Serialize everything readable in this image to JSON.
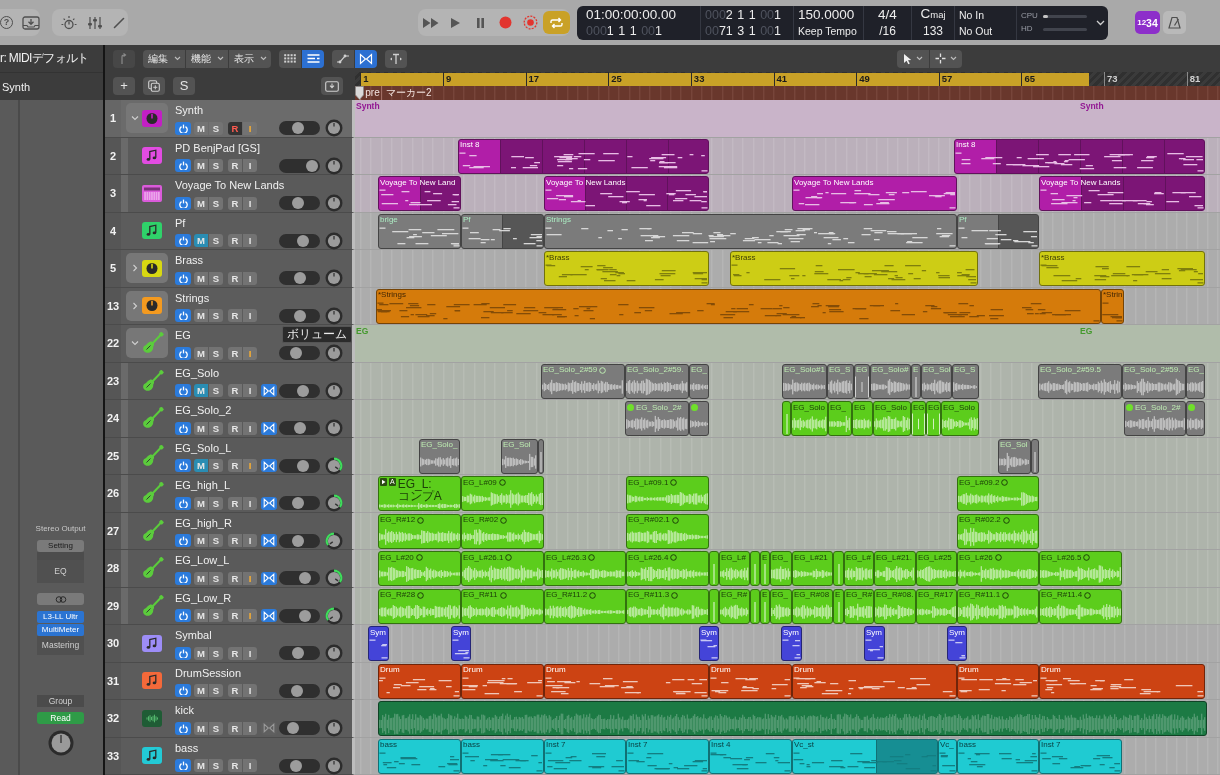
{
  "control_bar": {
    "help_label": "?",
    "cycle": {
      "on": true
    },
    "count_in": {
      "label": "1234",
      "on": true
    }
  },
  "lcd": {
    "smpte": "01:00:00:00.00",
    "position": "0001 1 1 001",
    "left_locator": "0002 1 1 001",
    "right_locator": "0071 3 1 001",
    "tempo": "150.0000",
    "tempo_mode": "Keep Tempo",
    "time_signature": "4/4",
    "division": "/16",
    "key": {
      "root": "C",
      "mode": "maj"
    },
    "key_row_2": "133",
    "midi_in": "No In",
    "midi_out": "No Out",
    "meters": [
      {
        "label": "CPU",
        "level": 0.12
      },
      {
        "label": "HD",
        "level": 0
      }
    ]
  },
  "inspector": {
    "title": "r: MIDIデフォルト",
    "track": "Synth",
    "channel_strip": {
      "output": "Stereo Output",
      "setting": "Setting",
      "eq": "EQ",
      "plugins": [
        "L3-LL Ultr",
        "MultiMeter"
      ],
      "slot": "Mastering",
      "group": "Group",
      "automation": "Read"
    }
  },
  "arrange_toolbar": {
    "menus": [
      {
        "label": "編集"
      },
      {
        "label": "機能"
      },
      {
        "label": "表示"
      }
    ],
    "view_buttons": [
      {
        "kind": "grid",
        "selected": false
      },
      {
        "kind": "list",
        "selected": true
      }
    ],
    "mode_buttons": [
      {
        "kind": "automation",
        "selected": false
      },
      {
        "kind": "flex",
        "selected": true
      }
    ]
  },
  "track_actions": [
    {
      "kind": "add",
      "label": "+"
    },
    {
      "kind": "duplicate"
    },
    {
      "kind": "solo",
      "label": "S"
    }
  ],
  "ruler": {
    "bars": [
      "1",
      "9",
      "17",
      "25",
      "33",
      "41",
      "49",
      "57",
      "65",
      "73",
      "81"
    ],
    "markers": [
      {
        "label": "pre"
      },
      {
        "label": "マーカー2"
      }
    ]
  },
  "tracks": [
    {
      "number": "1",
      "name": "Synth",
      "kind": "stack",
      "selected": true,
      "expanded": true,
      "color": "#c21fc4",
      "power": true,
      "buttons": [
        {
          "kind": "mute",
          "label": "M",
          "on": false
        },
        {
          "kind": "solo",
          "label": "S",
          "on": false
        },
        {
          "kind": "record",
          "label": "R",
          "on": true
        },
        {
          "kind": "input",
          "label": "I",
          "on": true
        }
      ],
      "volume": {
        "level": 0.46
      },
      "pan": {
        "left": false,
        "right": false
      },
      "regions": [
        {
          "label": "Synth",
          "color": "#c9b4c9"
        },
        {
          "label": "Synth",
          "color": "#c9b4c9"
        }
      ],
      "children": [
        {
          "number": "2",
          "name": "PD BenjPad [GS]",
          "kind": "instrument",
          "selected": false,
          "color": "#e24ce2",
          "power": true,
          "buttons": [
            {
              "kind": "mute",
              "label": "M",
              "on": false
            },
            {
              "kind": "solo",
              "label": "S",
              "on": false
            },
            {
              "kind": "record",
              "label": "R",
              "on": false
            },
            {
              "kind": "input",
              "label": "I",
              "on": false
            }
          ],
          "volume": {
            "level": 0.95
          },
          "pan": {
            "left": false,
            "right": false
          },
          "regions": [
            {
              "label": "Inst 8",
              "color": "#b11ea8"
            },
            {
              "label": "Inst 8",
              "color": "#b11ea8"
            }
          ]
        },
        {
          "number": "3",
          "name": "Voyage To New Lands",
          "kind": "synth",
          "selected": false,
          "color": "#da5bda",
          "power": true,
          "buttons": [
            {
              "kind": "mute",
              "label": "M",
              "on": false
            },
            {
              "kind": "solo",
              "label": "S",
              "on": false
            },
            {
              "kind": "record",
              "label": "R",
              "on": false
            },
            {
              "kind": "input",
              "label": "I",
              "on": false
            }
          ],
          "volume": {
            "level": 0.46
          },
          "pan": {
            "left": false,
            "right": false
          },
          "regions": [
            {
              "label": "Voyage To New Land",
              "color": "#b11ea8"
            },
            {
              "label": "Voyage To New Lands",
              "color": "#b11ea8"
            },
            {
              "label": "Voyage To New Lands",
              "color": "#b11ea8"
            },
            {
              "label": "Voyage To New Lands",
              "color": "#b11ea8"
            }
          ]
        }
      ]
    },
    {
      "number": "4",
      "name": "Pf",
      "kind": "instrument",
      "selected": false,
      "color": "#2fd26a",
      "power": true,
      "buttons": [
        {
          "kind": "mute",
          "label": "M",
          "on": true
        },
        {
          "kind": "solo",
          "label": "S",
          "on": false
        },
        {
          "kind": "record",
          "label": "R",
          "on": false
        },
        {
          "kind": "input",
          "label": "I",
          "on": false
        }
      ],
      "volume": {
        "level": 0.64
      },
      "pan": {
        "left": false,
        "right": false
      },
      "regions": [
        {
          "label": "brige"
        },
        {
          "label": "Pf"
        },
        {
          "label": "Strings"
        },
        {
          "label": "Pf"
        }
      ]
    },
    {
      "number": "5",
      "name": "Brass",
      "kind": "stack",
      "selected": false,
      "expanded": false,
      "color": "#d8d812",
      "power": true,
      "buttons": [
        {
          "kind": "mute",
          "label": "M",
          "on": false
        },
        {
          "kind": "solo",
          "label": "S",
          "on": false
        },
        {
          "kind": "record",
          "label": "R",
          "on": false
        },
        {
          "kind": "input",
          "label": "I",
          "on": false
        }
      ],
      "volume": {
        "level": 0.5
      },
      "pan": {
        "left": false,
        "right": false
      },
      "regions": [
        {
          "label": "*Brass",
          "color": "#cdcd15"
        },
        {
          "label": "*Brass",
          "color": "#cdcd15"
        },
        {
          "label": "*Brass",
          "color": "#cdcd15"
        }
      ]
    },
    {
      "number": "13",
      "name": "Strings",
      "kind": "stack",
      "selected": false,
      "expanded": false,
      "color": "#f39a20",
      "power": true,
      "buttons": [
        {
          "kind": "mute",
          "label": "M",
          "on": false
        },
        {
          "kind": "solo",
          "label": "S",
          "on": false
        },
        {
          "kind": "record",
          "label": "R",
          "on": false
        },
        {
          "kind": "input",
          "label": "I",
          "on": false
        }
      ],
      "volume": {
        "level": 0.5
      },
      "pan": {
        "left": false,
        "right": false
      },
      "regions": [
        {
          "label": "*Strings",
          "color": "#d57b0b"
        },
        {
          "label": "*Strin",
          "color": "#d57b0b"
        }
      ]
    },
    {
      "number": "22",
      "name": "EG",
      "kind": "guitar_stack",
      "selected": false,
      "expanded": true,
      "color": "#5bcc3c",
      "power": true,
      "tooltip": "ボリューム",
      "buttons": [
        {
          "kind": "mute",
          "label": "M",
          "on": false
        },
        {
          "kind": "solo",
          "label": "S",
          "on": false
        },
        {
          "kind": "record",
          "label": "R",
          "on": false
        },
        {
          "kind": "input",
          "label": "I",
          "on": true
        }
      ],
      "volume": {
        "level": 0.36
      },
      "pan": {
        "left": false,
        "right": false
      },
      "regions": [
        {
          "label": "EG",
          "color": "#b0bcaa"
        },
        {
          "label": "EG",
          "color": "#b0bcaa"
        }
      ],
      "children": [
        {
          "number": "23",
          "name": "EG_Solo",
          "kind": "guitar",
          "selected": false,
          "color": "#5bcc3c",
          "power": true,
          "buttons": [
            {
              "kind": "mute",
              "label": "M",
              "on": true
            },
            {
              "kind": "solo",
              "label": "S",
              "on": false
            },
            {
              "kind": "record",
              "label": "R",
              "on": false
            },
            {
              "kind": "input",
              "label": "I",
              "on": false
            }
          ],
          "flex_button": {
            "on": true
          },
          "volume": {
            "level": 0.64
          },
          "pan": {
            "left": false,
            "right": false
          },
          "regions": [
            {
              "kind": "take",
              "label": "EG_Solo_2#59"
            },
            {
              "kind": "plain",
              "label": "EG_Solo_2#59."
            },
            {
              "kind": "plain",
              "label": "EG_"
            },
            {
              "kind": "plain",
              "label": "EG_Solo#1"
            },
            {
              "kind": "plain",
              "label": "EG_S"
            },
            {
              "kind": "plain",
              "label": "EG"
            },
            {
              "kind": "plain",
              "label": "EG_Solo#"
            },
            {
              "kind": "plain",
              "label": "E"
            },
            {
              "kind": "plain",
              "label": "EG_Sol"
            },
            {
              "kind": "plain",
              "label": "EG_S"
            },
            {
              "kind": "plain",
              "label": "EG_Solo_2#59.5"
            },
            {
              "kind": "plain",
              "label": "EG_Solo_2#59."
            },
            {
              "kind": "plain",
              "label": "EG_"
            }
          ]
        },
        {
          "number": "24",
          "name": "EG_Solo_2",
          "kind": "guitar",
          "selected": false,
          "color": "#5bcc3c",
          "power": true,
          "buttons": [
            {
              "kind": "mute",
              "label": "M",
              "on": false
            },
            {
              "kind": "solo",
              "label": "S",
              "on": false
            },
            {
              "kind": "record",
              "label": "R",
              "on": false
            },
            {
              "kind": "input",
              "label": "I",
              "on": false
            }
          ],
          "flex_button": {
            "on": true
          },
          "volume": {
            "level": 0.5
          },
          "pan": {
            "left": false,
            "right": false
          },
          "regions": [
            {
              "kind": "alt_take",
              "label": "EG_Solo_2#",
              "muted": true
            },
            {
              "kind": "alt_take",
              "muted": true
            },
            {
              "kind": "plain",
              "muted": false,
              "color": "#5ccd1c"
            },
            {
              "kind": "plain",
              "label": "EG_Solo",
              "muted": false,
              "color": "#5ccd1c"
            },
            {
              "kind": "plain",
              "label": "EG_",
              "muted": false,
              "color": "#5ccd1c"
            },
            {
              "kind": "plain",
              "label": "EG",
              "muted": false,
              "color": "#5ccd1c"
            },
            {
              "kind": "plain",
              "label": "EG_Solo",
              "muted": false,
              "color": "#5ccd1c"
            },
            {
              "kind": "plain",
              "label": "EG",
              "muted": false,
              "color": "#5ccd1c"
            },
            {
              "kind": "plain",
              "label": "EG",
              "muted": false,
              "color": "#5ccd1c"
            },
            {
              "kind": "plain",
              "label": "EG_Solo",
              "muted": false,
              "color": "#5ccd1c"
            },
            {
              "kind": "alt_take",
              "label": "EG_Solo_2#",
              "muted": true
            },
            {
              "kind": "alt_take",
              "muted": true
            }
          ]
        },
        {
          "number": "25",
          "name": "EG_Solo_L",
          "kind": "guitar",
          "selected": false,
          "color": "#5bcc3c",
          "power": true,
          "buttons": [
            {
              "kind": "mute",
              "label": "M",
              "on": true
            },
            {
              "kind": "solo",
              "label": "S",
              "on": false
            },
            {
              "kind": "record",
              "label": "R",
              "on": false
            },
            {
              "kind": "input",
              "label": "I",
              "on": true
            }
          ],
          "flex_button": {
            "on": true
          },
          "volume": {
            "level": 0.64
          },
          "pan": {
            "left": false,
            "right": true
          },
          "regions": [
            {
              "kind": "plain",
              "label": "EG_Solo_"
            },
            {
              "kind": "plain",
              "label": "EG_Sol"
            },
            {
              "kind": "plain"
            },
            {
              "kind": "plain",
              "label": "EG_Sol"
            },
            {
              "kind": "plain"
            }
          ]
        },
        {
          "number": "26",
          "name": "EG_high_L",
          "kind": "guitar",
          "selected": false,
          "color": "#5bcc3c",
          "power": true,
          "buttons": [
            {
              "kind": "mute",
              "label": "M",
              "on": false
            },
            {
              "kind": "solo",
              "label": "S",
              "on": false
            },
            {
              "kind": "record",
              "label": "R",
              "on": false
            },
            {
              "kind": "input",
              "label": "I",
              "on": false
            }
          ],
          "flex_button": {
            "on": true
          },
          "volume": {
            "level": 0.46
          },
          "pan": {
            "left": false,
            "right": true
          },
          "regions": [
            {
              "kind": "comp",
              "comp_take": "A",
              "label": "EG_L: コンプA",
              "color": "#5ccd1c"
            },
            {
              "kind": "take",
              "label": "EG_L#09",
              "color": "#5ccd1c"
            },
            {
              "kind": "take",
              "label": "EG_L#09.1",
              "color": "#5ccd1c"
            },
            {
              "kind": "take",
              "label": "EG_L#09.2",
              "color": "#5ccd1c"
            }
          ]
        },
        {
          "number": "27",
          "name": "EG_high_R",
          "kind": "guitar",
          "selected": false,
          "color": "#5bcc3c",
          "power": true,
          "buttons": [
            {
              "kind": "mute",
              "label": "M",
              "on": false
            },
            {
              "kind": "solo",
              "label": "S",
              "on": false
            },
            {
              "kind": "record",
              "label": "R",
              "on": false
            },
            {
              "kind": "input",
              "label": "I",
              "on": false
            }
          ],
          "flex_button": {
            "on": true
          },
          "volume": {
            "level": 0.46
          },
          "pan": {
            "left": true,
            "right": false
          },
          "regions": [
            {
              "kind": "take",
              "label": "EG_R#12",
              "color": "#5ccd1c"
            },
            {
              "kind": "take",
              "label": "EG_R#02",
              "color": "#5ccd1c"
            },
            {
              "kind": "take",
              "label": "EG_R#02.1",
              "color": "#5ccd1c"
            },
            {
              "kind": "take",
              "label": "EG_R#02.2",
              "color": "#5ccd1c"
            }
          ]
        },
        {
          "number": "28",
          "name": "EG_Low_L",
          "kind": "guitar",
          "selected": false,
          "color": "#5bcc3c",
          "power": true,
          "buttons": [
            {
              "kind": "mute",
              "label": "M",
              "on": false
            },
            {
              "kind": "solo",
              "label": "S",
              "on": false
            },
            {
              "kind": "record",
              "label": "R",
              "on": false
            },
            {
              "kind": "input",
              "label": "I",
              "on": true
            }
          ],
          "flex_button": {
            "on": true
          },
          "volume": {
            "level": 0.71
          },
          "pan": {
            "left": false,
            "right": true
          },
          "regions": [
            {
              "kind": "take",
              "label": "EG_L#20",
              "color": "#5ccd1c"
            },
            {
              "kind": "take",
              "label": "EG_L#26.1",
              "color": "#5ccd1c"
            },
            {
              "kind": "take",
              "label": "EG_L#26.3",
              "color": "#5ccd1c"
            },
            {
              "kind": "take",
              "label": "EG_L#26.4",
              "color": "#5ccd1c"
            },
            {
              "kind": "plain",
              "color": "#5ccd1c"
            },
            {
              "kind": "plain",
              "label": "EG_L#",
              "color": "#5ccd1c"
            },
            {
              "kind": "plain",
              "color": "#5ccd1c"
            },
            {
              "kind": "plain",
              "label": "E",
              "color": "#5ccd1c"
            },
            {
              "kind": "plain",
              "label": "EG_",
              "color": "#5ccd1c"
            },
            {
              "kind": "plain",
              "label": "EG_L#21",
              "color": "#5ccd1c"
            },
            {
              "kind": "plain",
              "color": "#5ccd1c"
            },
            {
              "kind": "plain",
              "label": "EG_L#",
              "color": "#5ccd1c"
            },
            {
              "kind": "plain",
              "label": "EG_L#21.",
              "color": "#5ccd1c"
            },
            {
              "kind": "plain",
              "label": "EG_L#25",
              "color": "#5ccd1c"
            },
            {
              "kind": "take",
              "label": "EG_L#26",
              "color": "#5ccd1c"
            },
            {
              "kind": "take",
              "label": "EG_L#26.5",
              "color": "#5ccd1c"
            }
          ]
        },
        {
          "number": "29",
          "name": "EG_Low_R",
          "kind": "guitar",
          "selected": false,
          "color": "#5bcc3c",
          "power": true,
          "buttons": [
            {
              "kind": "mute",
              "label": "M",
              "on": false
            },
            {
              "kind": "solo",
              "label": "S",
              "on": false
            },
            {
              "kind": "record",
              "label": "R",
              "on": false
            },
            {
              "kind": "input",
              "label": "I",
              "on": true
            }
          ],
          "flex_button": {
            "on": true
          },
          "volume": {
            "level": 0.71
          },
          "pan": {
            "left": true,
            "right": false
          },
          "regions": [
            {
              "kind": "take",
              "label": "EG_R#28",
              "color": "#5ccd1c"
            },
            {
              "kind": "take",
              "label": "EG_R#11",
              "color": "#5ccd1c"
            },
            {
              "kind": "take",
              "label": "EG_R#11.2",
              "color": "#5ccd1c"
            },
            {
              "kind": "take",
              "label": "EG_R#11.3",
              "color": "#5ccd1c"
            },
            {
              "kind": "plain",
              "color": "#5ccd1c"
            },
            {
              "kind": "plain",
              "label": "EG_R#",
              "color": "#5ccd1c"
            },
            {
              "kind": "plain",
              "color": "#5ccd1c"
            },
            {
              "kind": "plain",
              "label": "E",
              "color": "#5ccd1c"
            },
            {
              "kind": "plain",
              "label": "EG_",
              "color": "#5ccd1c"
            },
            {
              "kind": "plain",
              "label": "EG_R#08",
              "color": "#5ccd1c"
            },
            {
              "kind": "plain",
              "label": "E",
              "color": "#5ccd1c"
            },
            {
              "kind": "plain",
              "label": "EG_R#",
              "color": "#5ccd1c"
            },
            {
              "kind": "plain",
              "label": "EG_R#08.",
              "color": "#5ccd1c"
            },
            {
              "kind": "plain",
              "label": "EG_R#17",
              "color": "#5ccd1c"
            },
            {
              "kind": "take",
              "label": "EG_R#11.1",
              "color": "#5ccd1c"
            },
            {
              "kind": "take",
              "label": "EG_R#11.4",
              "color": "#5ccd1c"
            }
          ]
        }
      ]
    },
    {
      "number": "30",
      "name": "Symbal",
      "kind": "instrument",
      "selected": false,
      "color": "#9d8df7",
      "power": true,
      "buttons": [
        {
          "kind": "mute",
          "label": "M",
          "on": false
        },
        {
          "kind": "solo",
          "label": "S",
          "on": false
        },
        {
          "kind": "record",
          "label": "R",
          "on": false
        },
        {
          "kind": "input",
          "label": "I",
          "on": false
        }
      ],
      "volume": {
        "level": 0.46
      },
      "pan": {
        "left": false,
        "right": false
      },
      "regions": [
        {
          "label": "Sym",
          "color": "#4444d8"
        },
        {
          "label": "Sym",
          "color": "#4444d8"
        },
        {
          "label": "Sym",
          "color": "#4444d8"
        },
        {
          "label": "Sym",
          "color": "#4444d8"
        },
        {
          "label": "Sym",
          "color": "#4444d8"
        },
        {
          "label": "Sym",
          "color": "#4444d8"
        }
      ]
    },
    {
      "number": "31",
      "name": "DrumSession",
      "kind": "instrument",
      "selected": false,
      "color": "#f4693a",
      "power": true,
      "buttons": [
        {
          "kind": "mute",
          "label": "M",
          "on": false
        },
        {
          "kind": "solo",
          "label": "S",
          "on": false
        },
        {
          "kind": "record",
          "label": "R",
          "on": false
        },
        {
          "kind": "input",
          "label": "I",
          "on": false
        }
      ],
      "volume": {
        "level": 0.39
      },
      "pan": {
        "left": false,
        "right": false
      },
      "regions": [
        {
          "label": "Drum",
          "color": "#cc4313"
        },
        {
          "label": "Drum",
          "color": "#cc4313"
        },
        {
          "label": "Drum",
          "color": "#cc4313"
        },
        {
          "label": "Drum",
          "color": "#cc4313"
        },
        {
          "label": "Drum",
          "color": "#cc4313"
        },
        {
          "label": "Drum",
          "color": "#cc4313"
        },
        {
          "label": "Drum",
          "color": "#cc4313"
        }
      ]
    },
    {
      "number": "32",
      "name": "kick",
      "kind": "audio",
      "selected": false,
      "color": "#1f5c35",
      "power": true,
      "buttons": [
        {
          "kind": "mute",
          "label": "M",
          "on": false
        },
        {
          "kind": "solo",
          "label": "S",
          "on": false
        },
        {
          "kind": "record",
          "label": "R",
          "on": false
        },
        {
          "kind": "input",
          "label": "I",
          "on": false
        }
      ],
      "flex_button": {
        "on": false
      },
      "volume": {
        "level": 0.25
      },
      "pan": {
        "left": false,
        "right": false
      },
      "regions": [
        {
          "color": "#1c7a44"
        }
      ]
    },
    {
      "number": "33",
      "name": "bass",
      "kind": "instrument",
      "selected": false,
      "color": "#23cad6",
      "power": true,
      "buttons": [
        {
          "kind": "mute",
          "label": "M",
          "on": false
        },
        {
          "kind": "solo",
          "label": "S",
          "on": false
        },
        {
          "kind": "record",
          "label": "R",
          "on": false
        },
        {
          "kind": "input",
          "label": "I",
          "on": false
        }
      ],
      "volume": {
        "level": 0.36
      },
      "pan": {
        "left": false,
        "right": false
      },
      "regions": [
        {
          "label": "bass",
          "color": "#1fcbd2"
        },
        {
          "label": "bass",
          "color": "#1fcbd2"
        },
        {
          "label": "Inst 7",
          "color": "#1fcbd2"
        },
        {
          "label": "Inst 7",
          "color": "#1fcbd2"
        },
        {
          "label": "Inst 4",
          "color": "#1fcbd2"
        },
        {
          "label": "Vc_st",
          "color": "#1fcbd2"
        },
        {
          "label": "Vc_",
          "color": "#1fcbd2"
        },
        {
          "label": "bass",
          "color": "#1fcbd2"
        },
        {
          "label": "Inst 7",
          "color": "#1fcbd2"
        }
      ]
    }
  ]
}
